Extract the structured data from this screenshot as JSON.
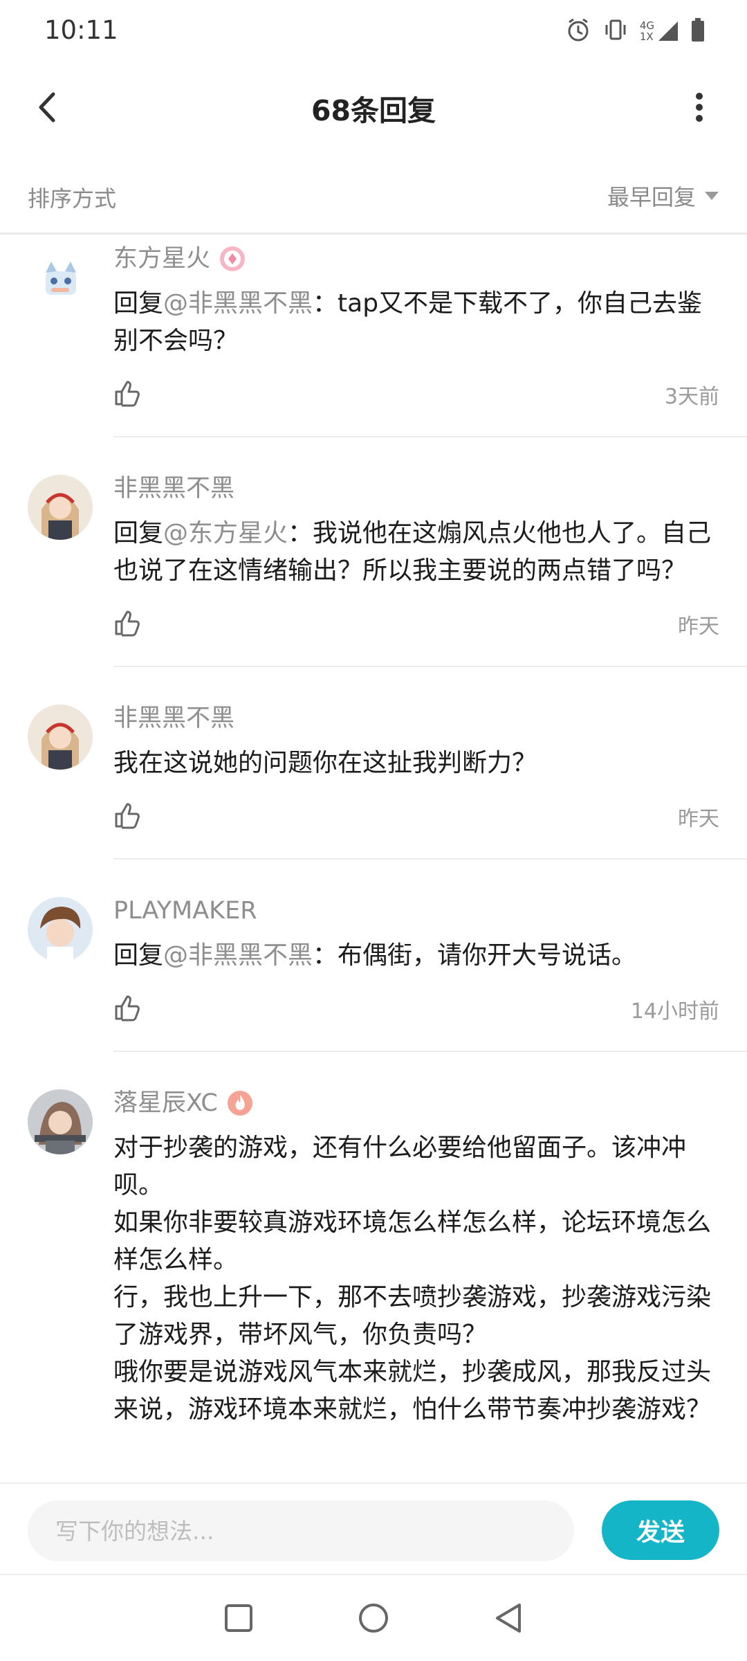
{
  "status_bar": {
    "time": "10:11",
    "network_label": "4G",
    "sim_label": "1X",
    "icons": [
      "alarm-icon",
      "vibrate-icon",
      "signal-icon",
      "battery-icon"
    ]
  },
  "app_bar": {
    "title": "68条回复",
    "back_icon": "chevron-left-icon",
    "more_icon": "more-vertical-icon"
  },
  "sort": {
    "label": "排序方式",
    "selected": "最早回复"
  },
  "comments": [
    {
      "name": "东方星火",
      "badge": "fan-badge-icon",
      "reply_prefix": "回复",
      "reply_to": "@非黑黑不黑",
      "text": "：tap又不是下载不了，你自己去鉴别不会吗？",
      "time": "3天前"
    },
    {
      "name": "非黑黑不黑",
      "reply_prefix": "回复",
      "reply_to": "@东方星火",
      "text": "：我说他在这煽风点火他也人了。自己也说了在这情绪输出？所以我主要说的两点错了吗？",
      "time": "昨天"
    },
    {
      "name": "非黑黑不黑",
      "reply_prefix": "",
      "reply_to": "",
      "text": "我在这说她的问题你在这扯我判断力？",
      "time": "昨天"
    },
    {
      "name": "PLAYMAKER",
      "reply_prefix": "回复",
      "reply_to": "@非黑黑不黑",
      "text": "：布偶街，请你开大号说话。",
      "time": "14小时前"
    },
    {
      "name": "落星辰XC",
      "badge": "flame-badge-icon",
      "reply_prefix": "",
      "reply_to": "",
      "text": "对于抄袭的游戏，还有什么必要给他留面子。该冲冲呗。\n如果你非要较真游戏环境怎么样怎么样，论坛环境怎么样怎么样。\n行，我也上升一下，那不去喷抄袭游戏，抄袭游戏污染了游戏界，带坏风气，你负责吗？\n哦你要是说游戏风气本来就烂，抄袭成风，那我反过头来说，游戏环境本来就烂，怕什么带节奏冲抄袭游戏？",
      "time": ""
    }
  ],
  "composer": {
    "placeholder": "写下你的想法...",
    "send_label": "发送"
  },
  "colors": {
    "accent": "#14b5c6",
    "muted_text": "#8e8e8e",
    "badge_pink": "#f08aa0",
    "badge_orange": "#f07a6a"
  }
}
